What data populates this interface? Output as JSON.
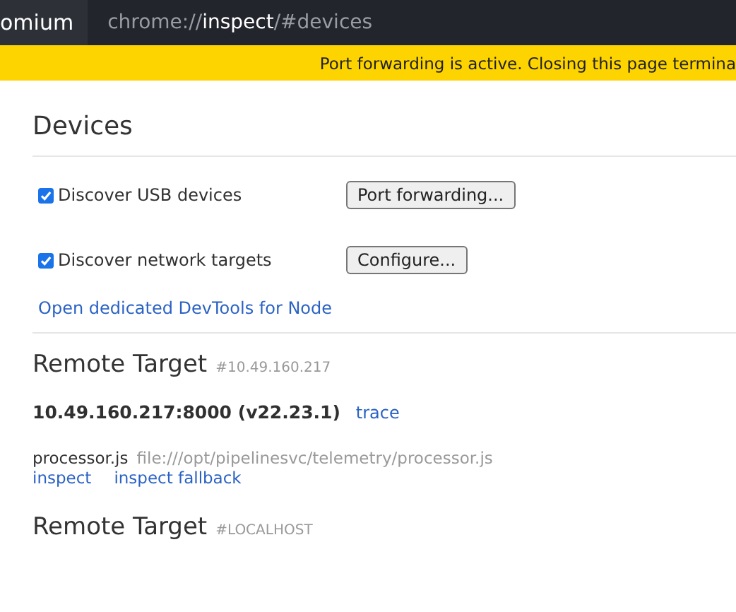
{
  "browser": {
    "tab_title": "omium",
    "url": "chrome://**inspect**/#devices"
  },
  "infobar": {
    "text": "Port forwarding is active. Closing this page termina"
  },
  "devices": {
    "title": "Devices",
    "options": [
      {
        "label": "Discover USB devices",
        "checked": true,
        "button": "Port forwarding..."
      },
      {
        "label": "Discover network targets",
        "checked": true,
        "button": "Configure..."
      }
    ],
    "link": "Open dedicated DevTools for Node"
  },
  "remote_targets": [
    {
      "title": "Remote Target",
      "hint": "#10.49.160.217",
      "device": "10.49.160.217:8000 (v22.23.1)",
      "device_action": "trace",
      "items": [
        {
          "name": "processor.js",
          "url": "file:///opt/pipelinesvc/telemetry/processor.js",
          "actions": [
            "inspect",
            "inspect fallback"
          ]
        }
      ]
    },
    {
      "title": "Remote Target",
      "hint": "#LOCALHOST"
    }
  ]
}
